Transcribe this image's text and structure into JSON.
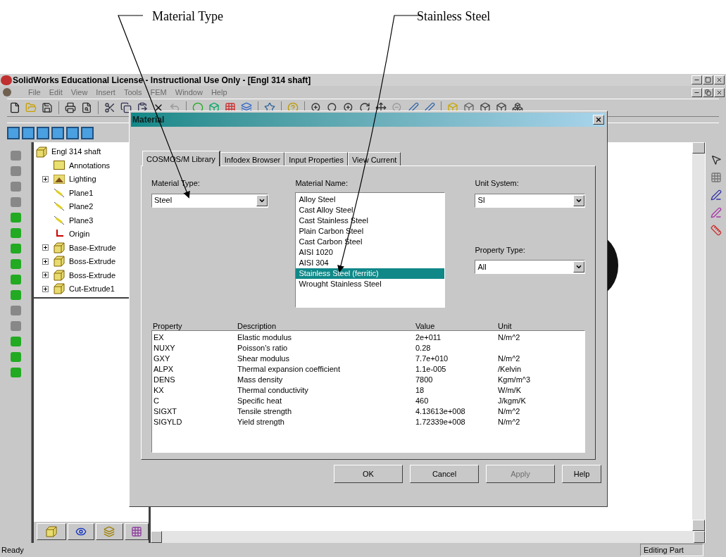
{
  "callouts": [
    {
      "label": "Material Type"
    },
    {
      "label": "Stainless Steel"
    }
  ],
  "window": {
    "title": "SolidWorks Educational License - Instructional Use Only - [Engl 314 shaft]"
  },
  "menu": [
    {
      "label": "File",
      "disabled": true
    },
    {
      "label": "Edit",
      "disabled": true
    },
    {
      "label": "View",
      "disabled": true
    },
    {
      "label": "Insert",
      "disabled": true
    },
    {
      "label": "Tools",
      "disabled": true
    },
    {
      "label": "FEM",
      "disabled": true
    },
    {
      "label": "Window",
      "disabled": true
    },
    {
      "label": "Help",
      "disabled": true
    }
  ],
  "feature_tree": {
    "label": "Engl 314 shaft",
    "children": [
      {
        "label": "Annotations",
        "kind": "annotation",
        "expandable": false
      },
      {
        "label": "Lighting",
        "kind": "lighting",
        "expandable": true
      },
      {
        "label": "Plane1",
        "kind": "plane",
        "expandable": false
      },
      {
        "label": "Plane2",
        "kind": "plane",
        "expandable": false
      },
      {
        "label": "Plane3",
        "kind": "plane",
        "expandable": false
      },
      {
        "label": "Origin",
        "kind": "origin",
        "expandable": false
      },
      {
        "label": "Base-Extrude",
        "kind": "extrude",
        "expandable": true
      },
      {
        "label": "Boss-Extrude",
        "kind": "extrude",
        "expandable": true
      },
      {
        "label": "Boss-Extrude",
        "kind": "extrude",
        "expandable": true
      },
      {
        "label": "Cut-Extrude1",
        "kind": "extrude",
        "expandable": true
      }
    ]
  },
  "dialog": {
    "title": "Material",
    "tabs": [
      {
        "label": "COSMOS/M Library",
        "selected": true
      },
      {
        "label": "Infodex Browser",
        "selected": false
      },
      {
        "label": "Input Properties",
        "selected": false
      },
      {
        "label": "View Current",
        "selected": false
      }
    ],
    "material_type": {
      "label": "Material Type:",
      "value": "Steel"
    },
    "material_name": {
      "label": "Material Name:",
      "items": [
        {
          "label": "Alloy Steel",
          "selected": false
        },
        {
          "label": "Cast Alloy Steel",
          "selected": false
        },
        {
          "label": "Cast Stainless Steel",
          "selected": false
        },
        {
          "label": "Plain Carbon Steel",
          "selected": false
        },
        {
          "label": "Cast Carbon Steel",
          "selected": false
        },
        {
          "label": "AISI 1020",
          "selected": false
        },
        {
          "label": "AISI 304",
          "selected": false
        },
        {
          "label": "Stainless Steel (ferritic)",
          "selected": true
        },
        {
          "label": "Wrought Stainless Steel",
          "selected": false
        }
      ]
    },
    "unit_system": {
      "label": "Unit System:",
      "value": "SI"
    },
    "property_type": {
      "label": "Property Type:",
      "value": "All"
    },
    "table": {
      "columns": [
        "Property",
        "Description",
        "Value",
        "Unit"
      ],
      "rows": [
        [
          "EX",
          "Elastic modulus",
          "2e+011",
          "N/m^2"
        ],
        [
          "NUXY",
          "Poisson's ratio",
          "0.28",
          ""
        ],
        [
          "GXY",
          "Shear modulus",
          "7.7e+010",
          "N/m^2"
        ],
        [
          "ALPX",
          "Thermal expansion coefficient",
          "1.1e-005",
          "/Kelvin"
        ],
        [
          "DENS",
          "Mass density",
          "7800",
          "Kgm/m^3"
        ],
        [
          "KX",
          "Thermal conductivity",
          "18",
          "W/m/K"
        ],
        [
          "C",
          "Specific heat",
          "460",
          "J/kgm/K"
        ],
        [
          "SIGXT",
          "Tensile strength",
          "4.13613e+008",
          "N/m^2"
        ],
        [
          "SIGYLD",
          "Yield strength",
          "1.72339e+008",
          "N/m^2"
        ]
      ]
    },
    "buttons": [
      {
        "label": "OK",
        "disabled": false
      },
      {
        "label": "Cancel",
        "disabled": false
      },
      {
        "label": "Apply",
        "disabled": true
      },
      {
        "label": "Help",
        "disabled": false
      }
    ]
  },
  "status_bar": {
    "message": "Ready",
    "mode": "Editing Part"
  }
}
